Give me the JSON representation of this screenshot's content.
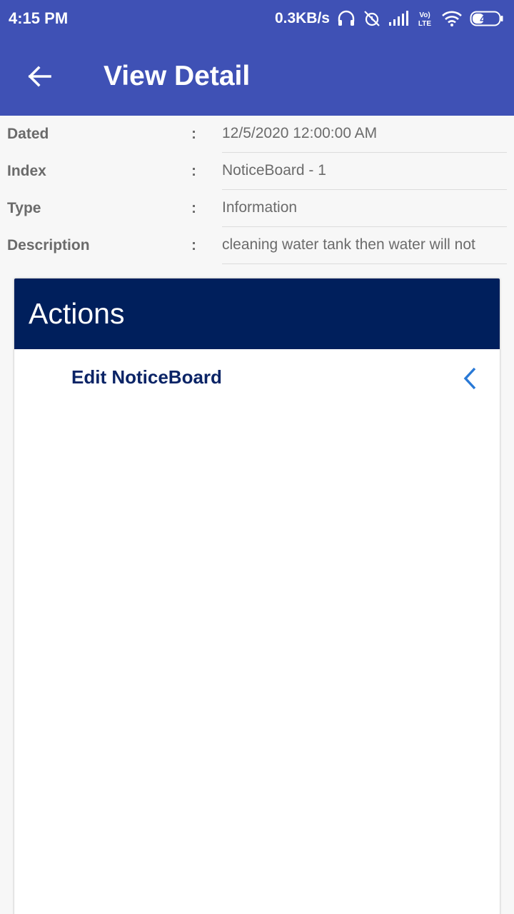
{
  "status_bar": {
    "time": "4:15 PM",
    "speed": "0.3KB/s",
    "network_label": "Vo) LTE",
    "battery": "42",
    "icons": [
      "headphones-icon",
      "alarm-off-icon",
      "signal-icon",
      "volte-icon",
      "wifi-icon",
      "battery-icon"
    ]
  },
  "toolbar": {
    "title": "View Detail",
    "back_icon": "arrow-left-icon"
  },
  "details": [
    {
      "label": "Dated",
      "colon": ":",
      "value": "12/5/2020 12:00:00 AM"
    },
    {
      "label": "Index",
      "colon": ":",
      "value": "NoticeBoard - 1"
    },
    {
      "label": "Type",
      "colon": ":",
      "value": "Information"
    },
    {
      "label": "Description",
      "colon": ":",
      "value": "cleaning water tank then water will not"
    }
  ],
  "actions": {
    "title": "Actions",
    "items": [
      {
        "label": "Edit NoticeBoard",
        "icon": "chevron-left-icon"
      }
    ]
  },
  "colors": {
    "appbar": "#3f51b5",
    "card_header": "#001f5c",
    "action_text": "#0b2466",
    "chevron": "#2979d6"
  }
}
